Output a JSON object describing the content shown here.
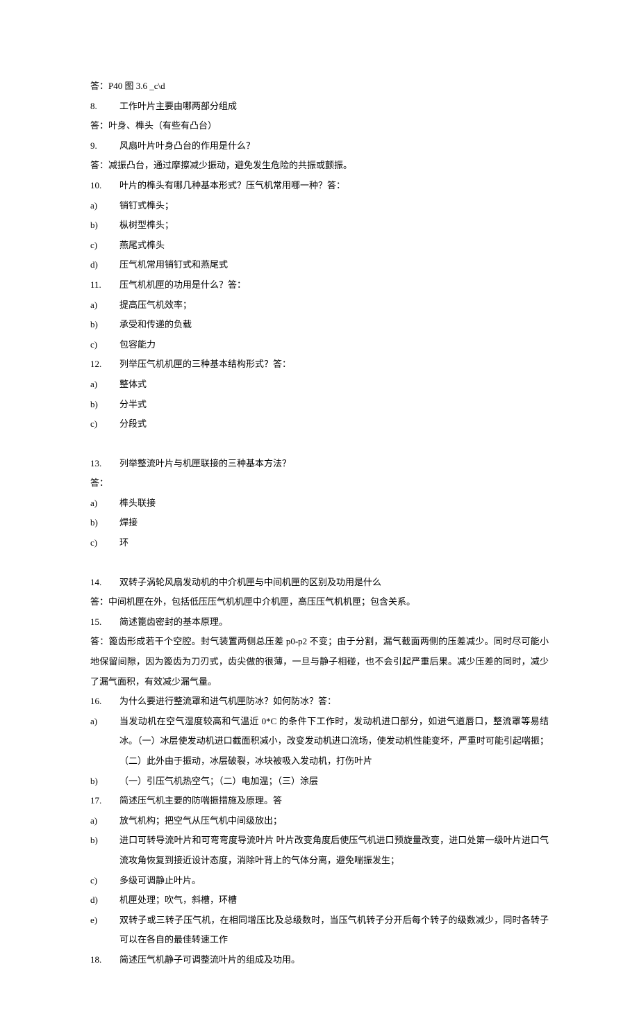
{
  "l1": "答：P40 图 3.6 _c\\d",
  "q8": {
    "num": "8.",
    "text": "工作叶片主要由哪两部分组成"
  },
  "a8": "答：叶身、榫头（有些有凸台）",
  "q9": {
    "num": "9.",
    "text": "风扇叶片叶身凸台的作用是什么？"
  },
  "a9": "答：减振凸台，通过摩擦减少振动，避免发生危险的共振或颤振。",
  "q10": {
    "num": "10.",
    "text": "叶片的榫头有哪几种基本形式？压气机常用哪一种？答："
  },
  "q10a": {
    "m": "a)",
    "t": "销钉式榫头；"
  },
  "q10b": {
    "m": "b)",
    "t": "枞树型榫头；"
  },
  "q10c": {
    "m": "c)",
    "t": "燕尾式榫头"
  },
  "q10d": {
    "m": "d)",
    "t": "压气机常用销钉式和燕尾式"
  },
  "q11": {
    "num": "11.",
    "text": "压气机机匣的功用是什么？答："
  },
  "q11a": {
    "m": "a)",
    "t": "提高压气机效率；"
  },
  "q11b": {
    "m": "b)",
    "t": "承受和传递的负载"
  },
  "q11c": {
    "m": "c)",
    "t": "包容能力"
  },
  "q12": {
    "num": "12.",
    "text": "列举压气机机匣的三种基本结构形式？答："
  },
  "q12a": {
    "m": "a)",
    "t": "整体式"
  },
  "q12b": {
    "m": "b)",
    "t": "分半式"
  },
  "q12c": {
    "m": "c)",
    "t": "分段式"
  },
  "q13": {
    "num": "13.",
    "text": "列举整流叶片与机匣联接的三种基本方法？"
  },
  "a13": "答：",
  "q13a": {
    "m": "a)",
    "t": "榫头联接"
  },
  "q13b": {
    "m": "b)",
    "t": "焊接"
  },
  "q13c": {
    "m": "c)",
    "t": "环"
  },
  "q14": {
    "num": "14.",
    "text": "双转子涡轮风扇发动机的中介机匣与中间机匣的区别及功用是什么"
  },
  "a14": "答：中间机匣在外，包括低压压气机机匣中介机匣，高压压气机机匣；包含关系。",
  "q15": {
    "num": "15.",
    "text": "简述篦齿密封的基本原理。"
  },
  "a15": "答：篦齿形成若干个空腔。封气装置两侧总压差 p0-p2 不变；由于分割，漏气截面两侧的压差减少。同时尽可能小地保留间隙，因为篦齿为刀刃式，齿尖做的很薄，一旦与静子相碰，也不会引起严重后果。减少压差的同时，减少了漏气面积，有效减少漏气量。",
  "q16": {
    "num": "16.",
    "text": "为什么要进行整流罩和进气机匣防冰？如何防冰？答："
  },
  "q16a": {
    "m": "a)",
    "t": "当发动机在空气湿度较高和气温近 0*C 的条件下工作时，发动机进口部分，如进气道唇口，整流罩等易结冰。（一）冰层使发动机进口截面积减小，改变发动机进口流场，使发动机性能变坏，严重时可能引起喘振；（二）此外由于振动，冰层破裂，冰块被吸入发动机，打伤叶片"
  },
  "q16b": {
    "m": "b)",
    "t": "（一）引压气机热空气；（二）电加温；（三）涂层"
  },
  "q17": {
    "num": "17.",
    "text": "简述压气机主要的防喘振措施及原理。答"
  },
  "q17a": {
    "m": "a)",
    "t": "放气机构；把空气从压气机中间级放出；"
  },
  "q17b": {
    "m": "b)",
    "t": "进口可转导流叶片和可弯弯度导流叶片  叶片改变角度后使压气机进口预旋量改变，进口处第一级叶片进口气流攻角恢复到接近设计态度，消除叶背上的气体分离，避免喘振发生；"
  },
  "q17c": {
    "m": "c)",
    "t": "多级可调静止叶片。"
  },
  "q17d": {
    "m": "d)",
    "t": "机匣处理；吹气，斜槽，环槽"
  },
  "q17e": {
    "m": "e)",
    "t": "双转子或三转子压气机，在相同增压比及总级数时，当压气机转子分开后每个转子的级数减少，同时各转子可以在各自的最佳转速工作"
  },
  "q18": {
    "num": "18.",
    "text": "简述压气机静子可调整流叶片的组成及功用。"
  }
}
